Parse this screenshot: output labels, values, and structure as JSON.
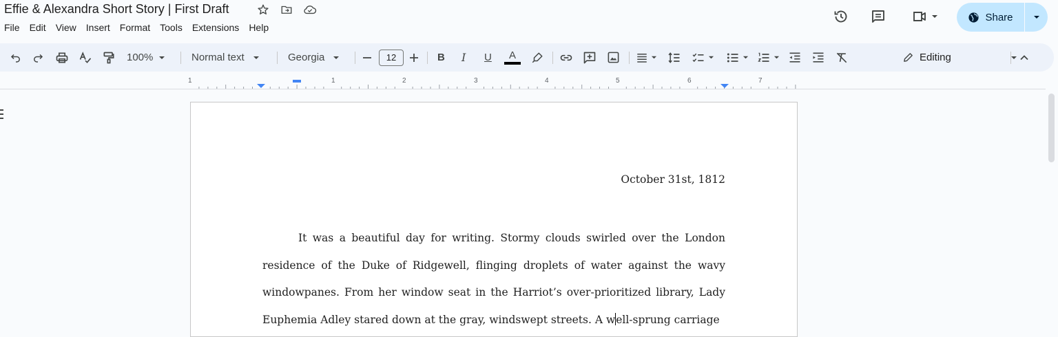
{
  "doc": {
    "title": "Effie & Alexandra Short Story | First Draft"
  },
  "menu": [
    "File",
    "Edit",
    "View",
    "Insert",
    "Format",
    "Tools",
    "Extensions",
    "Help"
  ],
  "header": {
    "share_label": "Share"
  },
  "toolbar": {
    "zoom": "100%",
    "style": "Normal text",
    "font": "Georgia",
    "font_size": "12",
    "bold": "B",
    "italic": "I",
    "underline": "U",
    "text_color": "A",
    "mode": "Editing"
  },
  "ruler": {
    "numbers": [
      "1",
      "1",
      "2",
      "3",
      "4",
      "5",
      "6",
      "7"
    ]
  },
  "page": {
    "date": "October 31st, 1812",
    "paragraph_before_cursor": "It was a beautiful day for writing. Stormy clouds swirled over the London residence of the Duke of Ridgewell, flinging droplets of water against the wavy windowpanes. From her window seat in the Harriot’s over-prioritized library, Lady Euphemia Adley stared down at the gray, windswept streets. A w",
    "paragraph_after_cursor": "ell-sprung carriage"
  },
  "colors": {
    "background": "#f9fbfd",
    "toolbar": "#edf2fa",
    "share_button": "#c2e7ff",
    "accent": "#0b57d0"
  },
  "icons": [
    "star-icon",
    "move-folder-icon",
    "cloud-saved-icon",
    "history-icon",
    "comment-icon",
    "video-call-icon",
    "globe-icon",
    "undo-icon",
    "redo-icon",
    "print-icon",
    "spellcheck-icon",
    "paint-format-icon",
    "highlighter-icon",
    "link-icon",
    "add-comment-icon",
    "insert-image-icon",
    "align-icon",
    "line-spacing-icon",
    "checklist-icon",
    "bulleted-list-icon",
    "numbered-list-icon",
    "decrease-indent-icon",
    "increase-indent-icon",
    "clear-formatting-icon",
    "pencil-icon",
    "collapse-icon",
    "outline-icon"
  ]
}
